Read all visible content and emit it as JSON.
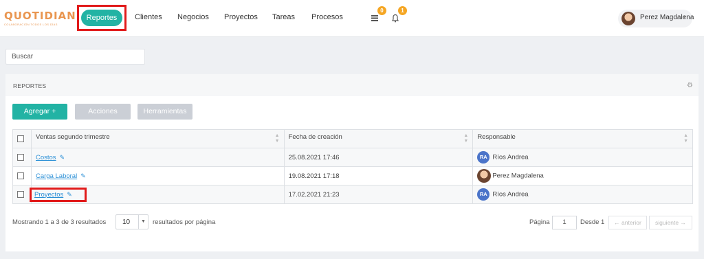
{
  "logo": {
    "word": "QUOTIDIAN",
    "tagline": "COLABORACIÓN TODOS LOS DÍAS"
  },
  "nav": {
    "items": [
      "Reportes",
      "Clientes",
      "Negocios",
      "Proyectos",
      "Tareas",
      "Procesos"
    ],
    "active": "Reportes"
  },
  "badges": {
    "tasks_count": "0",
    "notifications_count": "1"
  },
  "user": {
    "name": "Perez Magdalena"
  },
  "search": {
    "placeholder": "Buscar"
  },
  "panel": {
    "title": "REPORTES",
    "buttons": {
      "add": "Agregar +",
      "actions": "Acciones",
      "tools": "Herramientas"
    }
  },
  "table": {
    "columns": [
      "Ventas segundo trimestre",
      "Fecha de creación",
      "Responsable"
    ],
    "rows": [
      {
        "name": "Costos",
        "date": "25.08.2021 17:46",
        "owner": "Ríos Andrea",
        "initials": "RA"
      },
      {
        "name": "Carga Laboral",
        "date": "19.08.2021 17:18",
        "owner": "Perez Magdalena",
        "initials": ""
      },
      {
        "name": "Proyectos",
        "date": "17.02.2021 21:23",
        "owner": "Ríos Andrea",
        "initials": "RA"
      }
    ]
  },
  "footer": {
    "showing": "Mostrando 1 a 3 de 3 resultados",
    "per_page_value": "10",
    "per_page_label": "resultados por página",
    "page_label": "Página",
    "page_value": "1",
    "of_label": "Desde",
    "total_pages": "1",
    "prev": "← anterior",
    "next": "siguiente →"
  },
  "colors": {
    "accent": "#22b3a4",
    "highlight": "#e11a1a",
    "logo": "#e9954f",
    "badge": "#f5a623",
    "link": "#2a8fd6"
  }
}
